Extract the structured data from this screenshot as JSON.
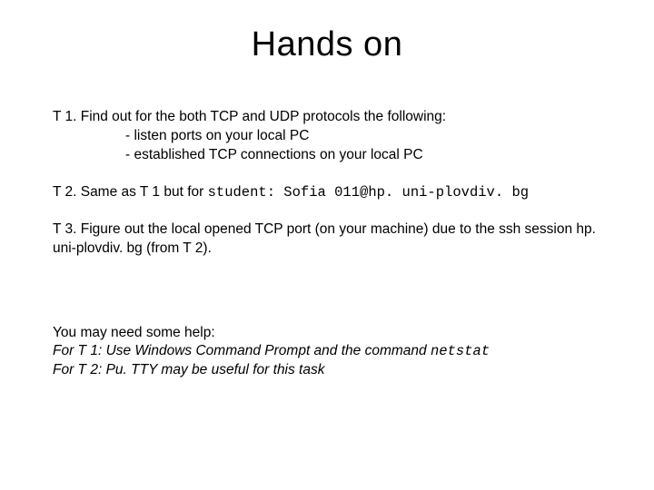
{
  "title": "Hands on",
  "t1": {
    "line": "T 1. Find out for the both TCP and UDP protocols the following:",
    "sub1": "- listen ports on your local PC",
    "sub2": "- established TCP connections on your local PC"
  },
  "t2": {
    "prefix": "T 2. Same as T 1 but for ",
    "code": "student: Sofia 011@hp. uni-plovdiv. bg"
  },
  "t3": {
    "text": "T 3. Figure out the local opened TCP port (on your machine) due to the ssh session hp. uni-plovdiv. bg (from T 2)."
  },
  "help": {
    "intro": "You may need some help:",
    "t1_prefix": "For T 1: Use Windows Command Prompt and the command ",
    "t1_code": "netstat",
    "t2": "For T 2: Pu. TTY may be useful for this task"
  }
}
